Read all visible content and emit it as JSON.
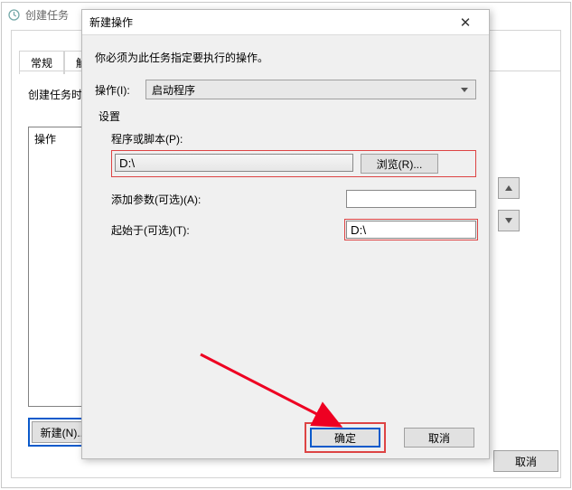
{
  "parent": {
    "title": "创建任务",
    "tabs": {
      "general": "常规",
      "trigger": "触发"
    },
    "create_label": "创建任务时",
    "list_header": "操作",
    "new_button": "新建(N)...",
    "cancel": "取消"
  },
  "modal": {
    "title": "新建操作",
    "instruction": "你必须为此任务指定要执行的操作。",
    "action_label": "操作(I):",
    "action_value": "启动程序",
    "settings_label": "设置",
    "program_label": "程序或脚本(P):",
    "program_value": "D:\\",
    "browse": "浏览(R)...",
    "args_label": "添加参数(可选)(A):",
    "args_value": "",
    "start_label": "起始于(可选)(T):",
    "start_value": "D:\\",
    "ok": "确定",
    "cancel": "取消"
  }
}
